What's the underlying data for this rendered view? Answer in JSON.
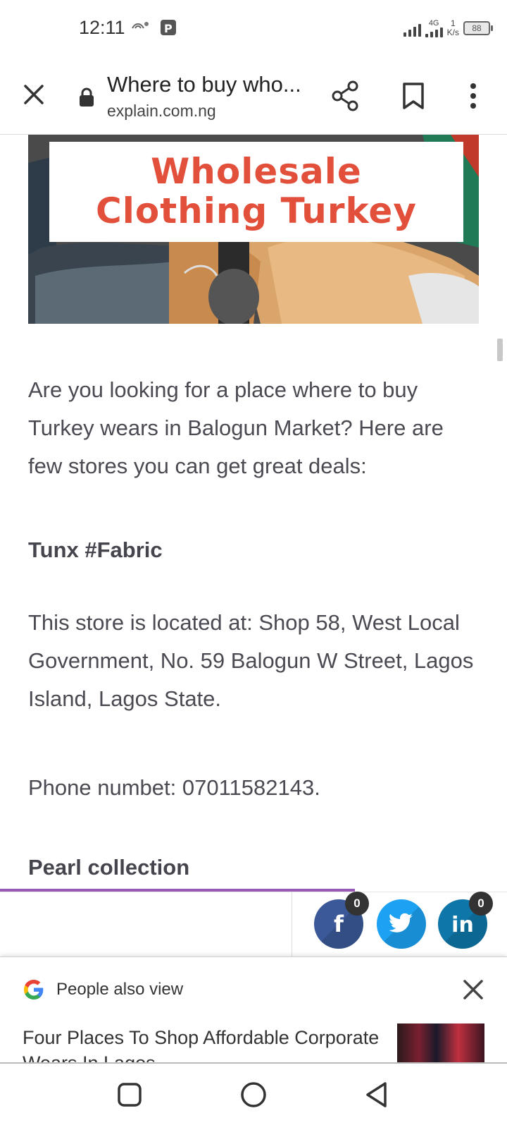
{
  "status_bar": {
    "time": "12:11",
    "network_type": "4G",
    "speed_value": "1",
    "speed_unit": "K/s",
    "battery": "88"
  },
  "toolbar": {
    "title": "Where to buy who...",
    "url": "explain.com.ng"
  },
  "hero": {
    "line1": "Wholesale",
    "line2": "Clothing Turkey"
  },
  "article": {
    "intro": "Are you looking for a place where to buy Turkey wears in Balogun Market? Here are few stores you can get great deals:",
    "store1_heading": "Tunx #Fabric",
    "store1_address": "This store is located at: Shop 58, West Local Government, No. 59 Balogun W Street, Lagos Island, Lagos State.",
    "store1_phone": "Phone numbet: 07011582143.",
    "store2_heading": "Pearl collection"
  },
  "reading_progress": 0.7,
  "share": {
    "facebook_count": "0",
    "linkedin_count": "0",
    "facebook_icon": "f",
    "linkedin_icon": "in",
    "colors": {
      "facebook": "#3b5998",
      "twitter": "#1da1f2",
      "linkedin": "#0e76a8",
      "progress": "#9b59b6"
    }
  },
  "people_also_view": {
    "label": "People also view",
    "article_title": "Four Places To Shop Affordable Corporate Wears In Lagos"
  },
  "icons": [
    "close-icon",
    "lock-icon",
    "share-icon",
    "bookmark-icon",
    "more-vert-icon",
    "google-icon",
    "square-icon",
    "circle-icon",
    "back-triangle-icon"
  ]
}
